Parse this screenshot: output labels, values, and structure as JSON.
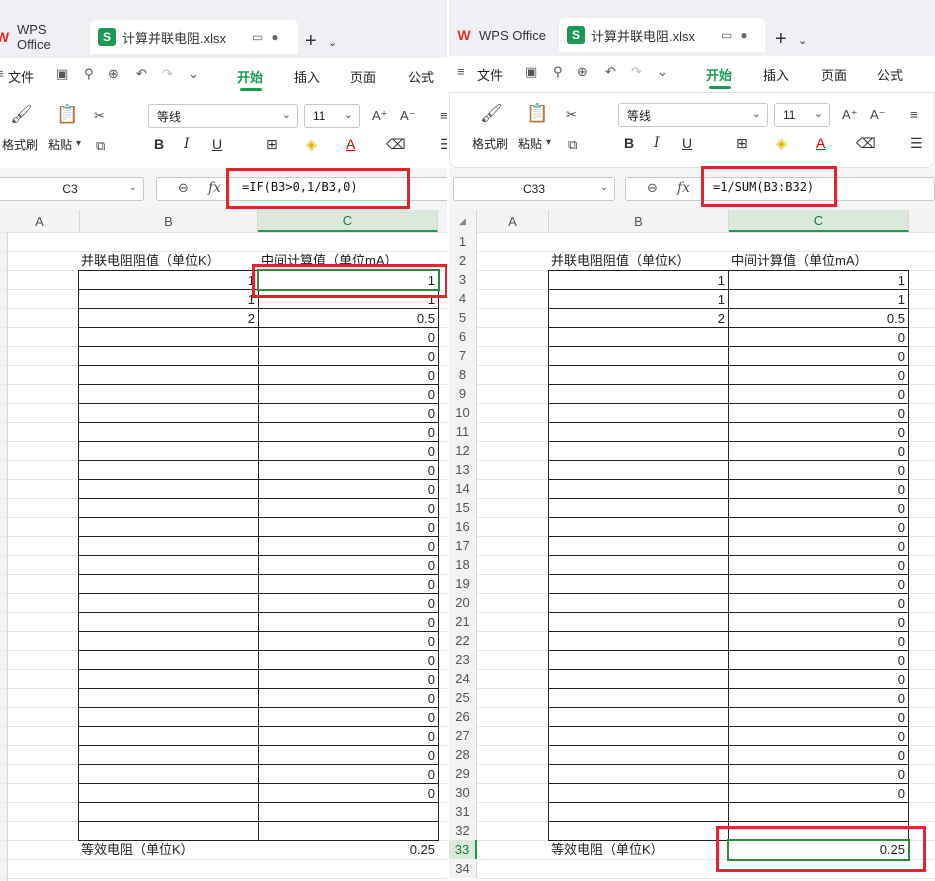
{
  "left": {
    "brand": "WPS Office",
    "file_tab": "计算并联电阻.xlsx",
    "menu": [
      "文件",
      "开始",
      "插入",
      "页面",
      "公式"
    ],
    "active_menu": "开始",
    "ribbon": {
      "format_painter": "格式刷",
      "paste": "粘贴",
      "font_name": "等线",
      "font_size": "11",
      "bold": "B",
      "italic": "I",
      "underline": "U"
    },
    "name_box": "C3",
    "formula": "=IF(B3>0,1/B3,0)",
    "columns": [
      "A",
      "B",
      "C"
    ],
    "header_b": "并联电阻阻值（单位K）",
    "header_c": "中间计算值（单位mA）",
    "b_values": [
      "1",
      "1",
      "2"
    ],
    "c_values": [
      "1",
      "1",
      "0.5",
      "0",
      "0",
      "0",
      "0",
      "0",
      "0",
      "0",
      "0",
      "0",
      "0",
      "0",
      "0",
      "0",
      "0",
      "0",
      "0",
      "0",
      "0",
      "0",
      "0",
      "0",
      "0",
      "0",
      "0",
      "0"
    ],
    "result_label": "等效电阻（单位K）",
    "result_value": "0.25"
  },
  "right": {
    "brand": "WPS Office",
    "file_tab": "计算并联电阻.xlsx",
    "menu": [
      "文件",
      "开始",
      "插入",
      "页面",
      "公式"
    ],
    "active_menu": "开始",
    "ribbon": {
      "format_painter": "格式刷",
      "paste": "粘贴",
      "font_name": "等线",
      "font_size": "11",
      "bold": "B",
      "italic": "I",
      "underline": "U"
    },
    "name_box": "C33",
    "formula": "=1/SUM(B3:B32)",
    "columns": [
      "A",
      "B",
      "C"
    ],
    "row_numbers": [
      "1",
      "2",
      "3",
      "4",
      "5",
      "6",
      "7",
      "8",
      "9",
      "10",
      "11",
      "12",
      "13",
      "14",
      "15",
      "16",
      "17",
      "18",
      "19",
      "20",
      "21",
      "22",
      "23",
      "24",
      "25",
      "26",
      "27",
      "28",
      "29",
      "30",
      "31",
      "32",
      "33",
      "34"
    ],
    "header_b": "并联电阻阻值（单位K）",
    "header_c": "中间计算值（单位mA）",
    "b_values": [
      "1",
      "1",
      "2"
    ],
    "c_values": [
      "1",
      "1",
      "0.5",
      "0",
      "0",
      "0",
      "0",
      "0",
      "0",
      "0",
      "0",
      "0",
      "0",
      "0",
      "0",
      "0",
      "0",
      "0",
      "0",
      "0",
      "0",
      "0",
      "0",
      "0",
      "0",
      "0",
      "0",
      "0"
    ],
    "result_label": "等效电阻（单位K）",
    "result_value": "0.25"
  },
  "colors": {
    "accent": "#1a9a55",
    "highlight": "#e0262a",
    "selection": "#2e8b3e"
  }
}
